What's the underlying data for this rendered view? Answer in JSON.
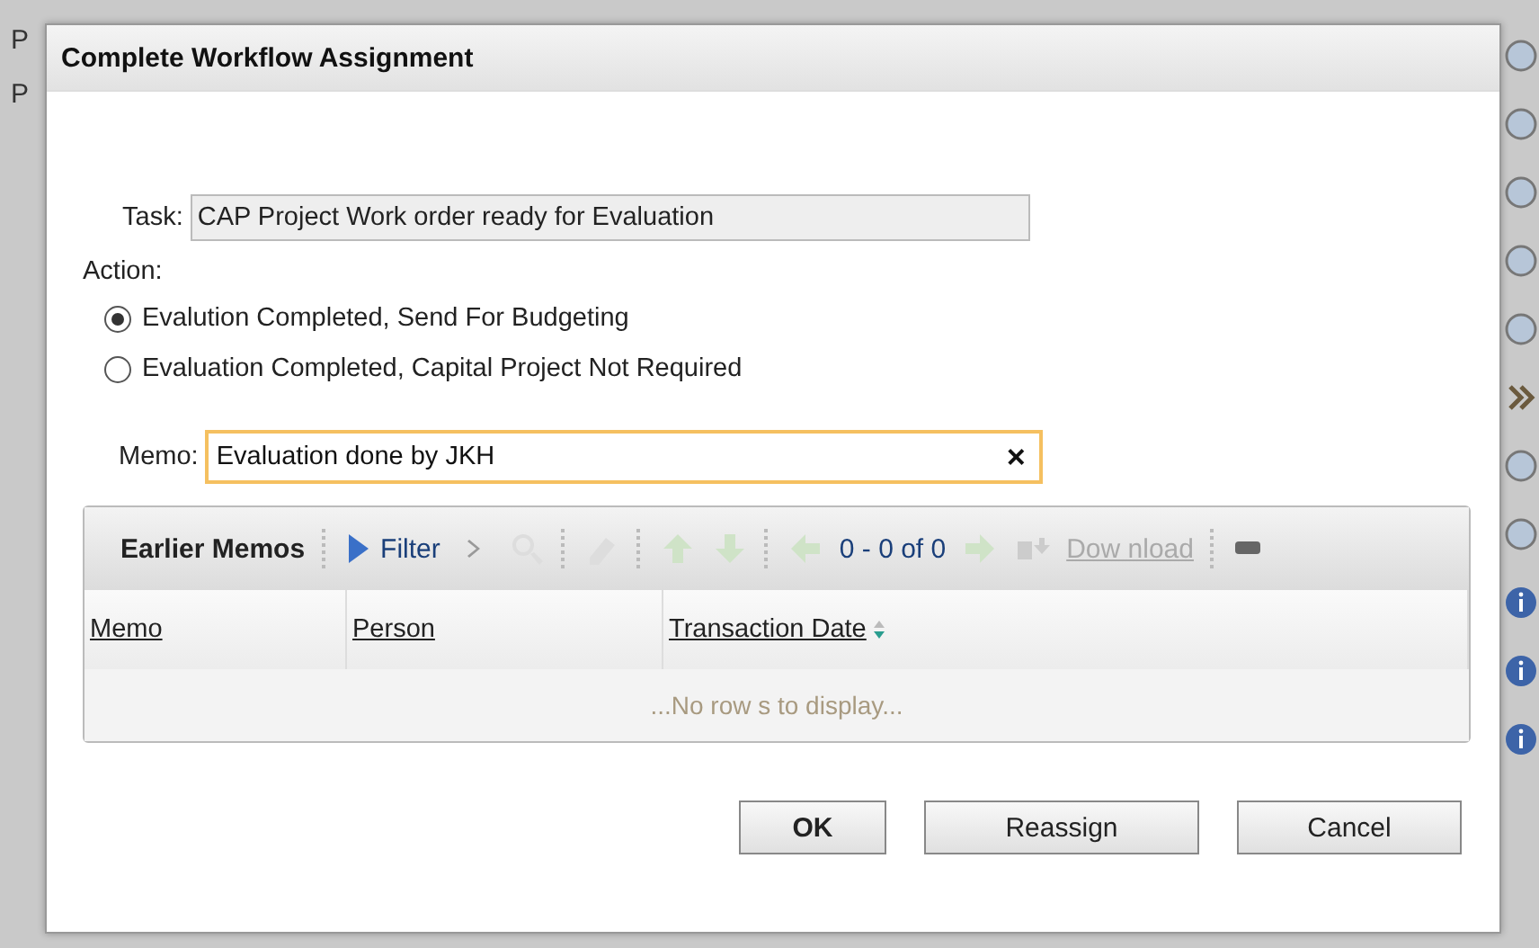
{
  "background": {
    "left_labels": [
      "P",
      "P"
    ],
    "right_icons": [
      {
        "kind": "circle"
      },
      {
        "kind": "circle"
      },
      {
        "kind": "circle"
      },
      {
        "kind": "circle"
      },
      {
        "kind": "circle"
      },
      {
        "kind": "chevron"
      },
      {
        "kind": "circle"
      },
      {
        "kind": "circle"
      },
      {
        "kind": "info"
      },
      {
        "kind": "info"
      },
      {
        "kind": "info"
      }
    ]
  },
  "dialog": {
    "title": "Complete Workflow Assignment",
    "task": {
      "label": "Task:",
      "value": "CAP Project Work order ready for Evaluation"
    },
    "action": {
      "label": "Action:",
      "options": [
        {
          "label": "Evalution Completed, Send For Budgeting",
          "selected": true
        },
        {
          "label": "Evaluation Completed, Capital Project Not Required",
          "selected": false
        }
      ]
    },
    "memo": {
      "label": "Memo:",
      "value": "Evaluation done by JKH",
      "clear": "×"
    },
    "earlier_memos": {
      "title": "Earlier Memos",
      "filter": "Filter",
      "pager": "0 - 0 of 0",
      "download": "Dow nload",
      "columns": [
        {
          "label": "Memo",
          "sortable": false
        },
        {
          "label": "Person",
          "sortable": false
        },
        {
          "label": "Transaction Date",
          "sortable": true
        }
      ],
      "empty": "...No row s to display..."
    },
    "buttons": [
      {
        "label": "OK",
        "default": true
      },
      {
        "label": "Reassign",
        "default": false
      },
      {
        "label": "Cancel",
        "default": false
      }
    ]
  }
}
